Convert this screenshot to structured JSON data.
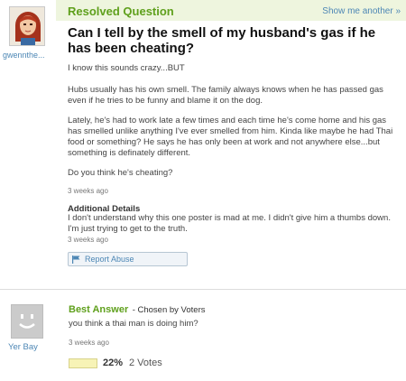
{
  "question": {
    "status_title": "Resolved Question",
    "show_more": "Show me another »",
    "asker_name": "gwennthe...",
    "title": "Can I tell by the smell of my husband's gas if he has been cheating?",
    "body": [
      "I know this sounds crazy...BUT",
      "Hubs usually has his own smell. The family always knows when he has passed gas even if he tries to be funny and blame it on the dog.",
      "Lately, he's had to work late a few times and each time he's come home and his gas has smelled unlike anything I've ever smelled from him. Kinda like maybe he had Thai food or something? He says he has only been at work and not anywhere else...but something is definately different.",
      "Do you think he's cheating?"
    ],
    "time": "3 weeks ago",
    "additional_details_heading": "Additional Details",
    "additional_details": "I don't understand why this one poster is mad at me. I didn't give him a thumbs down. I'm just trying to get to the truth.",
    "additional_time": "3 weeks ago",
    "report_label": "Report Abuse",
    "icons": [
      "user-avatar-icon",
      "flag-icon"
    ]
  },
  "answer": {
    "label": "Best Answer",
    "chosen_by": "- Chosen by Voters",
    "text": "you think a thai man is doing him?",
    "time": "3 weeks ago",
    "user_name": "Yer Bay",
    "vote_percent": "22%",
    "vote_fraction": 0.22,
    "votes": "2 Votes",
    "icons": [
      "default-avatar-icon"
    ]
  },
  "colors": {
    "accent_green": "#5fa01c",
    "link_blue": "#4d87b5",
    "header_bg": "#eef5de",
    "vote_bar": "#f7f3b6"
  }
}
